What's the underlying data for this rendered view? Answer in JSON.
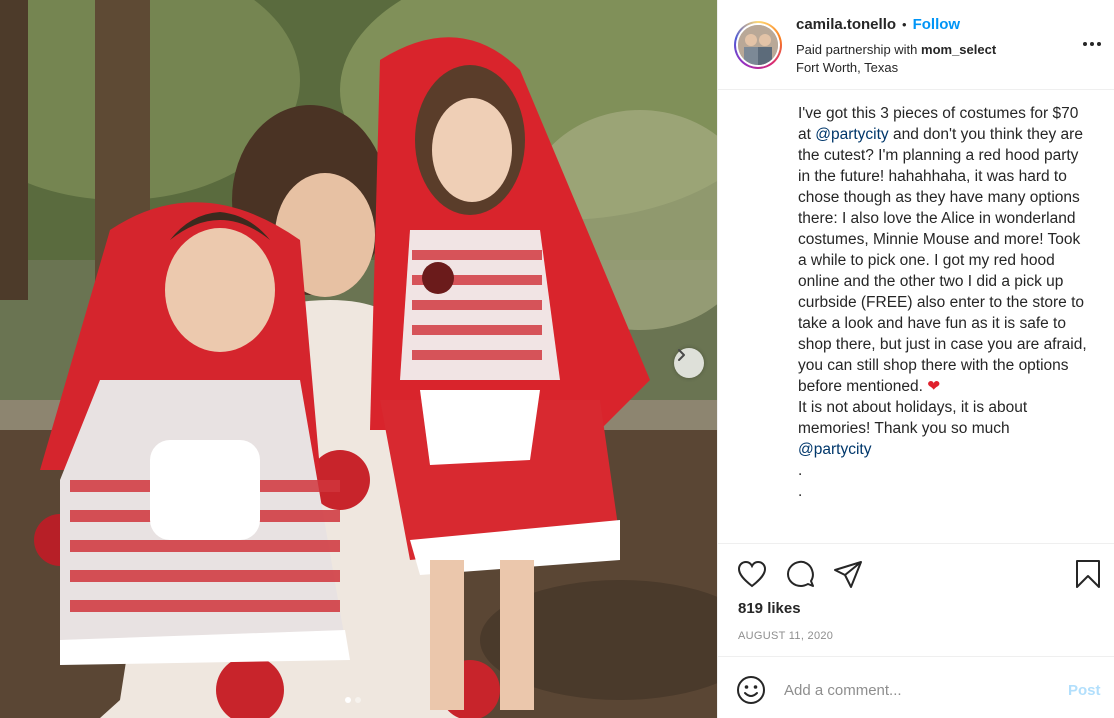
{
  "post": {
    "username": "camila.tonello",
    "follow_label": "Follow",
    "separator": "•",
    "partnership_prefix": "Paid partnership with ",
    "partner": "mom_select",
    "location": "Fort Worth, Texas",
    "caption_part1": "I've got this 3 pieces of costumes for $70 at ",
    "caption_tag1": "@partycity",
    "caption_part2": " and don't you think they are the cutest? I'm planning a red hood party in the future! hahahhaha, it was hard to chose though as they have many options there: I also love the Alice in wonderland costumes, Minnie Mouse and more! Took a while to pick one. I got my red hood online and the other two I did a pick up curbside (FREE) also enter to the store to take a look and have fun as it is safe to shop there, but just in case you are afraid, you can still shop there with the options before mentioned. ",
    "caption_heart": "❤",
    "caption_part3": "\nIt is not about holidays, it is about memories! Thank you so much\n",
    "caption_tag2": "@partycity",
    "caption_part4": "\n.\n.",
    "likes": "819 likes",
    "date": "August 11, 2020",
    "comment_placeholder": "Add a comment...",
    "post_label": "Post"
  },
  "carousel": {
    "total": 2,
    "active": 1
  },
  "colors": {
    "follow": "#0095f6",
    "post_disabled": "#b2dffc",
    "tag": "#00376b",
    "heart": "#e0212d"
  },
  "icons": [
    "next-arrow-icon",
    "more-options-icon",
    "like-heart-icon",
    "comment-icon",
    "share-icon",
    "save-bookmark-icon",
    "emoji-icon"
  ]
}
